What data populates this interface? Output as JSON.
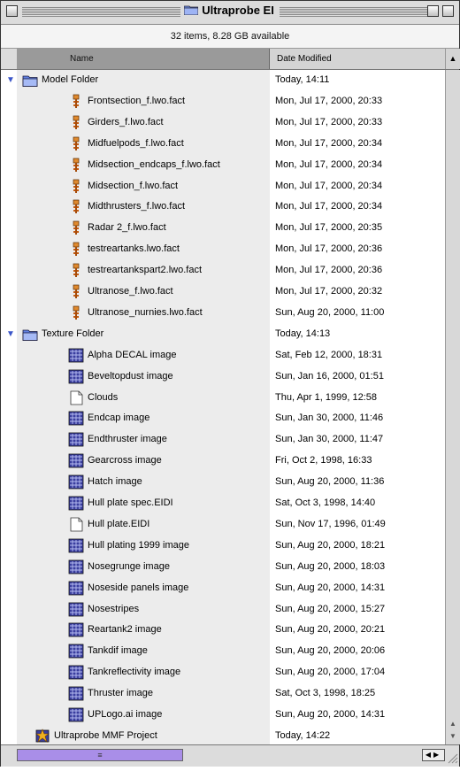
{
  "window": {
    "title": "Ultraprobe EI",
    "info": "32 items, 8.28 GB available"
  },
  "columns": {
    "name": "Name",
    "date": "Date Modified"
  },
  "rows": [
    {
      "name": "Model Folder",
      "date": "Today, 14:11",
      "icon": "folder-icon",
      "indent": 0,
      "expanded": true
    },
    {
      "name": "Frontsection_f.lwo.fact",
      "date": "Mon, Jul 17, 2000, 20:33",
      "icon": "lightwave-file-icon",
      "indent": 1
    },
    {
      "name": "Girders_f.lwo.fact",
      "date": "Mon, Jul 17, 2000, 20:33",
      "icon": "lightwave-file-icon",
      "indent": 1
    },
    {
      "name": "Midfuelpods_f.lwo.fact",
      "date": "Mon, Jul 17, 2000, 20:34",
      "icon": "lightwave-file-icon",
      "indent": 1
    },
    {
      "name": "Midsection_endcaps_f.lwo.fact",
      "date": "Mon, Jul 17, 2000, 20:34",
      "icon": "lightwave-file-icon",
      "indent": 1
    },
    {
      "name": "Midsection_f.lwo.fact",
      "date": "Mon, Jul 17, 2000, 20:34",
      "icon": "lightwave-file-icon",
      "indent": 1
    },
    {
      "name": "Midthrusters_f.lwo.fact",
      "date": "Mon, Jul 17, 2000, 20:34",
      "icon": "lightwave-file-icon",
      "indent": 1
    },
    {
      "name": "Radar 2_f.lwo.fact",
      "date": "Mon, Jul 17, 2000, 20:35",
      "icon": "lightwave-file-icon",
      "indent": 1
    },
    {
      "name": "testreartanks.lwo.fact",
      "date": "Mon, Jul 17, 2000, 20:36",
      "icon": "lightwave-file-icon",
      "indent": 1
    },
    {
      "name": "testreartankspart2.lwo.fact",
      "date": "Mon, Jul 17, 2000, 20:36",
      "icon": "lightwave-file-icon",
      "indent": 1
    },
    {
      "name": "Ultranose_f.lwo.fact",
      "date": "Mon, Jul 17, 2000, 20:32",
      "icon": "lightwave-file-icon",
      "indent": 1
    },
    {
      "name": "Ultranose_nurnies.lwo.fact",
      "date": "Sun, Aug 20, 2000, 11:00",
      "icon": "lightwave-file-icon",
      "indent": 1
    },
    {
      "name": "Texture Folder",
      "date": "Today, 14:13",
      "icon": "folder-icon",
      "indent": 0,
      "expanded": true
    },
    {
      "name": "Alpha DECAL image",
      "date": "Sat, Feb 12, 2000, 18:31",
      "icon": "image-file-icon",
      "indent": 1
    },
    {
      "name": "Beveltopdust image",
      "date": "Sun, Jan 16, 2000, 01:51",
      "icon": "image-file-icon",
      "indent": 1
    },
    {
      "name": "Clouds",
      "date": "Thu, Apr 1, 1999, 12:58",
      "icon": "document-icon",
      "indent": 1
    },
    {
      "name": "Endcap image",
      "date": "Sun, Jan 30, 2000, 11:46",
      "icon": "image-file-icon",
      "indent": 1
    },
    {
      "name": "Endthruster image",
      "date": "Sun, Jan 30, 2000, 11:47",
      "icon": "image-file-icon",
      "indent": 1
    },
    {
      "name": "Gearcross image",
      "date": "Fri, Oct 2, 1998, 16:33",
      "icon": "image-file-icon",
      "indent": 1
    },
    {
      "name": "Hatch image",
      "date": "Sun, Aug 20, 2000, 11:36",
      "icon": "image-file-icon",
      "indent": 1
    },
    {
      "name": "Hull plate spec.EIDI",
      "date": "Sat, Oct 3, 1998, 14:40",
      "icon": "image-file-icon",
      "indent": 1
    },
    {
      "name": "Hull plate.EIDI",
      "date": "Sun, Nov 17, 1996, 01:49",
      "icon": "document-icon",
      "indent": 1
    },
    {
      "name": "Hull plating 1999 image",
      "date": "Sun, Aug 20, 2000, 18:21",
      "icon": "image-file-icon",
      "indent": 1
    },
    {
      "name": "Nosegrunge image",
      "date": "Sun, Aug 20, 2000, 18:03",
      "icon": "image-file-icon",
      "indent": 1
    },
    {
      "name": "Noseside panels image",
      "date": "Sun, Aug 20, 2000, 14:31",
      "icon": "image-file-icon",
      "indent": 1
    },
    {
      "name": "Nosestripes",
      "date": "Sun, Aug 20, 2000, 15:27",
      "icon": "image-file-icon",
      "indent": 1
    },
    {
      "name": "Reartank2 image",
      "date": "Sun, Aug 20, 2000, 20:21",
      "icon": "image-file-icon",
      "indent": 1
    },
    {
      "name": "Tankdif image",
      "date": "Sun, Aug 20, 2000, 20:06",
      "icon": "image-file-icon",
      "indent": 1
    },
    {
      "name": "Tankreflectivity image",
      "date": "Sun, Aug 20, 2000, 17:04",
      "icon": "image-file-icon",
      "indent": 1
    },
    {
      "name": "Thruster image",
      "date": "Sat, Oct 3, 1998, 18:25",
      "icon": "image-file-icon",
      "indent": 1
    },
    {
      "name": "UPLogo.ai image",
      "date": "Sun, Aug 20, 2000, 14:31",
      "icon": "image-file-icon",
      "indent": 1
    },
    {
      "name": "Ultraprobe MMF Project",
      "date": "Today, 14:22",
      "icon": "project-file-icon",
      "indent": 0
    }
  ],
  "colors": {
    "selected_column": "#9a9a9a",
    "folder_blue": "#4f6fd8",
    "scroll_thumb": "#a98ee8"
  }
}
